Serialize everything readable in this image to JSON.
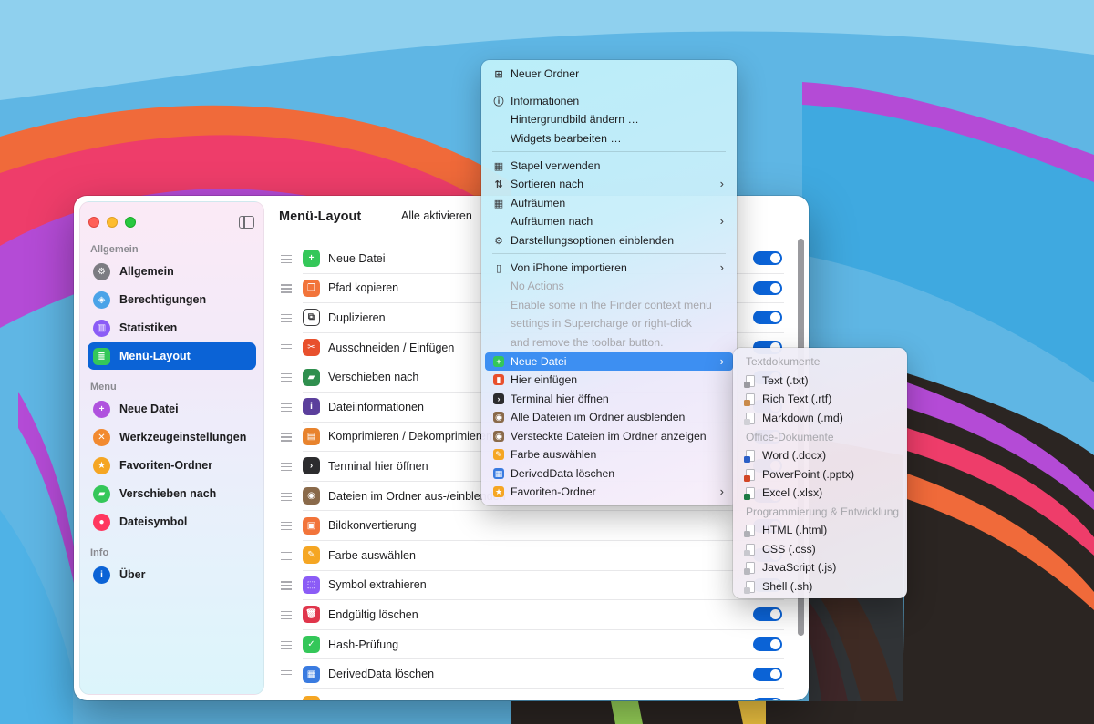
{
  "window": {
    "title": "Menü-Layout",
    "enable_all_label": "Alle aktivieren"
  },
  "sidebar": {
    "sections": [
      {
        "title": "Allgemein",
        "items": [
          {
            "label": "Allgemein",
            "icon": "gear-icon",
            "color": "#7c7c82"
          },
          {
            "label": "Berechtigungen",
            "icon": "shield-icon",
            "color": "#4aa3e8"
          },
          {
            "label": "Statistiken",
            "icon": "chart-icon",
            "color": "#8b5cf6"
          },
          {
            "label": "Menü-Layout",
            "icon": "list-icon",
            "color": "#34c759",
            "active": true
          }
        ]
      },
      {
        "title": "Menu",
        "items": [
          {
            "label": "Neue Datei",
            "icon": "new-file-icon",
            "color": "#af52de"
          },
          {
            "label": "Werkzeugeinstellungen",
            "icon": "tools-icon",
            "color": "#f28a30"
          },
          {
            "label": "Favoriten-Ordner",
            "icon": "star-icon",
            "color": "#f5a623"
          },
          {
            "label": "Verschieben nach",
            "icon": "folder-move-icon",
            "color": "#34c759"
          },
          {
            "label": "Dateisymbol",
            "icon": "palette-icon",
            "color": "#ff375f"
          }
        ]
      },
      {
        "title": "Info",
        "items": [
          {
            "label": "Über",
            "icon": "info-icon",
            "color": "#0b63d6"
          }
        ]
      }
    ]
  },
  "rows": [
    {
      "label": "Neue Datei",
      "icon": "new-file-icon",
      "color": "#34c759",
      "enabled": true
    },
    {
      "label": "Pfad kopieren",
      "icon": "copy-path-icon",
      "color": "#f2743a",
      "enabled": true
    },
    {
      "label": "Duplizieren",
      "icon": "duplicate-icon",
      "color": "#3a3a3c",
      "enabled": true
    },
    {
      "label": "Ausschneiden / Einfügen",
      "icon": "scissors-icon",
      "color": "#e8502d",
      "enabled": true
    },
    {
      "label": "Verschieben nach",
      "icon": "folder-move-icon",
      "color": "#2f8f4e",
      "enabled": true
    },
    {
      "label": "Dateiinformationen",
      "icon": "info-icon",
      "color": "#5b3f9c",
      "enabled": true
    },
    {
      "label": "Komprimieren / Dekomprimieren",
      "icon": "archive-icon",
      "color": "#e8832d",
      "enabled": true
    },
    {
      "label": "Terminal hier öffnen",
      "icon": "terminal-icon",
      "color": "#2c2c2e",
      "enabled": true
    },
    {
      "label": "Dateien im Ordner aus-/einblenden",
      "icon": "eye-icon",
      "color": "#8a6a4a",
      "enabled": true
    },
    {
      "label": "Bildkonvertierung",
      "icon": "image-icon",
      "color": "#f2743a",
      "enabled": true
    },
    {
      "label": "Farbe auswählen",
      "icon": "eyedropper-icon",
      "color": "#f5a623",
      "enabled": true
    },
    {
      "label": "Symbol extrahieren",
      "icon": "extract-icon",
      "color": "#8b5cf6",
      "enabled": true
    },
    {
      "label": "Endgültig löschen",
      "icon": "trash-icon",
      "color": "#e0354b",
      "enabled": true
    },
    {
      "label": "Hash-Prüfung",
      "icon": "check-icon",
      "color": "#34c759",
      "enabled": true
    },
    {
      "label": "DerivedData löschen",
      "icon": "trash-icon",
      "color": "#3a7be0",
      "enabled": true
    }
  ],
  "context_menu": {
    "items": [
      {
        "label": "Neuer Ordner",
        "icon": "new-folder-icon"
      },
      {
        "separator": true
      },
      {
        "label": "Informationen",
        "icon": "info-icon"
      },
      {
        "label": "Hintergrundbild ändern …"
      },
      {
        "label": "Widgets bearbeiten …"
      },
      {
        "separator": true
      },
      {
        "label": "Stapel verwenden",
        "icon": "grid-icon"
      },
      {
        "label": "Sortieren nach",
        "icon": "sort-icon",
        "submenu": true
      },
      {
        "label": "Aufräumen",
        "icon": "grid-icon"
      },
      {
        "label": "Aufräumen nach",
        "submenu": true
      },
      {
        "label": "Darstellungsoptionen einblenden",
        "icon": "gear-icon"
      },
      {
        "separator": true
      },
      {
        "label": "Von iPhone importieren",
        "icon": "iphone-icon",
        "submenu": true
      },
      {
        "label": "No Actions",
        "disabled": true
      },
      {
        "label": "Enable some in the Finder context menu",
        "disabled": true
      },
      {
        "label": "settings in Supercharge or right-click",
        "disabled": true
      },
      {
        "label": "and remove the toolbar button.",
        "disabled": true
      },
      {
        "label": "Neue Datei",
        "icon": "new-file-icon",
        "color": "#34c759",
        "submenu": true,
        "selected": true
      },
      {
        "label": "Hier einfügen",
        "icon": "paste-icon",
        "color": "#e8502d"
      },
      {
        "label": "Terminal hier öffnen",
        "icon": "terminal-icon",
        "color": "#2c2c2e"
      },
      {
        "label": "Alle Dateien im Ordner ausblenden",
        "icon": "eye-icon",
        "color": "#8a6a4a"
      },
      {
        "label": "Versteckte Dateien im Ordner anzeigen",
        "icon": "eye-icon",
        "color": "#8a6a4a"
      },
      {
        "label": "Farbe auswählen",
        "icon": "eyedropper-icon",
        "color": "#f5a623"
      },
      {
        "label": "DerivedData löschen",
        "icon": "trash-icon",
        "color": "#3a7be0"
      },
      {
        "label": "Favoriten-Ordner",
        "icon": "star-icon",
        "color": "#f5a623",
        "submenu": true
      }
    ]
  },
  "submenu": {
    "groups": [
      {
        "title": "Textdokumente",
        "items": [
          {
            "label": "Text (.txt)",
            "icon": "txt-file-icon",
            "color": "#9a9aa0"
          },
          {
            "label": "Rich Text (.rtf)",
            "icon": "rtf-file-icon",
            "color": "#c98a4a"
          },
          {
            "label": "Markdown (.md)",
            "icon": "md-file-icon",
            "color": "#d0d0d6"
          }
        ]
      },
      {
        "title": "Office-Dokumente",
        "items": [
          {
            "label": "Word (.docx)",
            "icon": "word-file-icon",
            "color": "#2b5fc7"
          },
          {
            "label": "PowerPoint (.pptx)",
            "icon": "powerpoint-file-icon",
            "color": "#d24726"
          },
          {
            "label": "Excel (.xlsx)",
            "icon": "excel-file-icon",
            "color": "#1e7b45"
          }
        ]
      },
      {
        "title": "Programmierung & Entwicklung",
        "items": [
          {
            "label": "HTML (.html)",
            "icon": "html-file-icon",
            "color": "#b0b0b6"
          },
          {
            "label": "CSS (.css)",
            "icon": "css-file-icon",
            "color": "#c8c8ce"
          },
          {
            "label": "JavaScript (.js)",
            "icon": "js-file-icon",
            "color": "#b8b8be"
          },
          {
            "label": "Shell (.sh)",
            "icon": "sh-file-icon",
            "color": "#c8c8ce"
          }
        ]
      }
    ]
  }
}
